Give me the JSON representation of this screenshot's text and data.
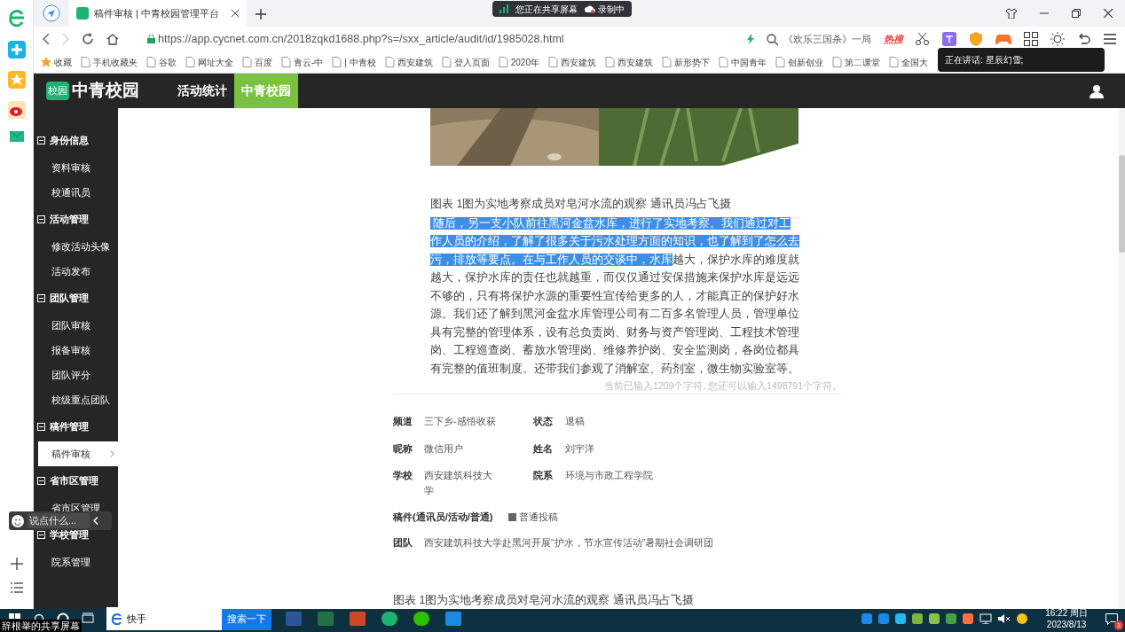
{
  "screen_share": {
    "sharing": "您正在共享屏幕",
    "recording": "录制中"
  },
  "browser": {
    "tab_title": "稿件审核 | 中青校园管理平台",
    "url": "https://app.cycnet.com.cn/2018zqkd1688.php?s=/sxx_article/audit/id/1985028.html",
    "search_hint": "《欢乐三国杀》一局",
    "hot_label": "热搜",
    "bookmarks": [
      "收藏",
      "手机收藏夹",
      "谷歌",
      "网址大全",
      "百度",
      "青云-中",
      "| 中青校",
      "西安建筑",
      "登入页面",
      "2020年",
      "西安建筑",
      "西安建筑",
      "新形势下",
      "中国青年",
      "创新创业",
      "第二课堂",
      "全国大"
    ]
  },
  "speaker_tooltip": "正在讲话:  星辰幻雪;",
  "site": {
    "logo_badge": "校园",
    "brand": "中青校园",
    "nav": [
      {
        "label": "活动统计",
        "selected": false
      },
      {
        "label": "中青校园",
        "selected": true
      }
    ]
  },
  "sidebar": {
    "groups": [
      {
        "label": "身份信息",
        "expanded": true,
        "items": [
          {
            "label": "资料审核",
            "selected": false
          },
          {
            "label": "校通讯员",
            "selected": false
          }
        ]
      },
      {
        "label": "活动管理",
        "expanded": true,
        "items": [
          {
            "label": "修改活动头像",
            "selected": false
          },
          {
            "label": "活动发布",
            "selected": false
          }
        ]
      },
      {
        "label": "团队管理",
        "expanded": true,
        "items": [
          {
            "label": "团队审核",
            "selected": false
          },
          {
            "label": "报备审核",
            "selected": false
          },
          {
            "label": "团队评分",
            "selected": false
          },
          {
            "label": "校级重点团队",
            "selected": false
          }
        ]
      },
      {
        "label": "稿件管理",
        "expanded": true,
        "items": [
          {
            "label": "稿件审核",
            "selected": true
          }
        ]
      },
      {
        "label": "省市区管理",
        "expanded": true,
        "items": [
          {
            "label": "省市区管理",
            "selected": false
          }
        ]
      },
      {
        "label": "学校管理",
        "expanded": true,
        "items": [
          {
            "label": "院系管理",
            "selected": false
          }
        ]
      }
    ]
  },
  "article": {
    "caption": "图表 1图为实地考察成员对皂河水流的观察 通讯员冯占飞摄",
    "paragraph": {
      "selected_text": "随后，另一支小队前往黑河金盆水库，进行了实地考察。我们通过对工作人员的介绍，了解了很多关于污水处理方面的知识，也了解到了怎么去污，排放等要点。在与工作人员的交谈中，水库",
      "text": "越大，保护水库的难度就越大，保护水库的责任也就越重，而仅仅通过安保措施来保护水库是远远不够的，只有将保护水源的重要性宣传给更多的人，才能真正的保护好水源。我们还了解到黑河金盆水库管理公司有二百多名管理人员，管理单位具有完整的管理体系，设有总负责岗、财务与资产管理岗、工程技术管理岗、工程巡查岗、蓄放水管理岗、维修养护岗、安全监测岗，各岗位都具有完整的值班制度。还带我们参观了消解室、药剂室，微生物实验室等。"
    },
    "counter": "当前已输入1209个字符, 您还可以输入1498791个字符。"
  },
  "details": {
    "fields": [
      {
        "label": "频道",
        "value": "三下乡-感悟收获"
      },
      {
        "label": "状态",
        "value": "退稿"
      },
      {
        "label": "昵称",
        "value": "微信用户"
      },
      {
        "label": "姓名",
        "value": "刘宇洋"
      },
      {
        "label": "学校",
        "value": "西安建筑科技大学"
      },
      {
        "label": "院系",
        "value": "环境与市政工程学院"
      }
    ],
    "type_label": "稿件(通讯员/活动/普通)",
    "type_option": {
      "label": "普通投稿",
      "checked": true
    },
    "team": {
      "label": "团队",
      "value": "西安建筑科技大学赴黑河开展“护水，节水宣传活动”暑期社会调研团"
    }
  },
  "caption_2": "图表 1图为实地考察成员对皂河水流的观察 通讯员冯占飞摄",
  "chat": {
    "placeholder": "说点什么..."
  },
  "share_label": "辞根举的共享屏幕",
  "taskbar": {
    "search_value": "快手",
    "search_button": "搜索一下",
    "time": "16:22 周日",
    "date": "2023/8/13",
    "notification_count": "3"
  }
}
